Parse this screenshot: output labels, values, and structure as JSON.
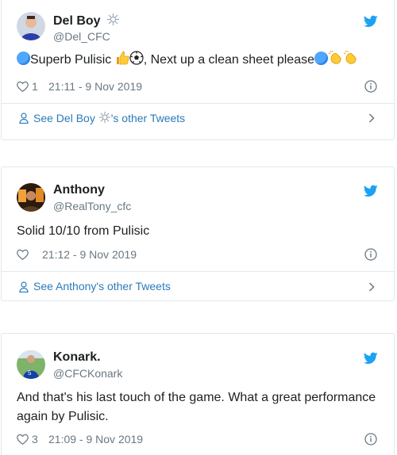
{
  "tweets": [
    {
      "name": "Del Boy",
      "handle": "@Del_CFC",
      "text_a": "Superb Pulisic",
      "text_b": ", Next up a clean sheet please",
      "likes": "1",
      "time": "21:11 - 9 Nov 2019",
      "other_prefix": "See Del Boy",
      "other_suffix": "'s other Tweets"
    },
    {
      "name": "Anthony",
      "handle": "@RealTony_cfc",
      "text": "Solid 10/10 from Pulisic",
      "likes": "",
      "time": "21:12 - 9 Nov 2019",
      "other": "See Anthony's other Tweets"
    },
    {
      "name": "Konark.",
      "handle": "@CFCKonark",
      "text": "And that's his last touch of the game. What a great performance again by Pulisic.",
      "likes": "3",
      "time": "21:09 - 9 Nov 2019"
    }
  ],
  "colors": {
    "twitter_blue": "#1da1f2",
    "link": "#2b7bb9",
    "meta": "#697882",
    "border": "#e1e8ed"
  },
  "icons": [
    "twitter-bird-icon",
    "heart-icon",
    "info-icon",
    "person-icon",
    "chevron-right-icon",
    "blue-circle-emoji",
    "thumbs-up-emoji",
    "soccer-ball-emoji",
    "clapping-hands-emoji",
    "sparkle-emoji"
  ]
}
